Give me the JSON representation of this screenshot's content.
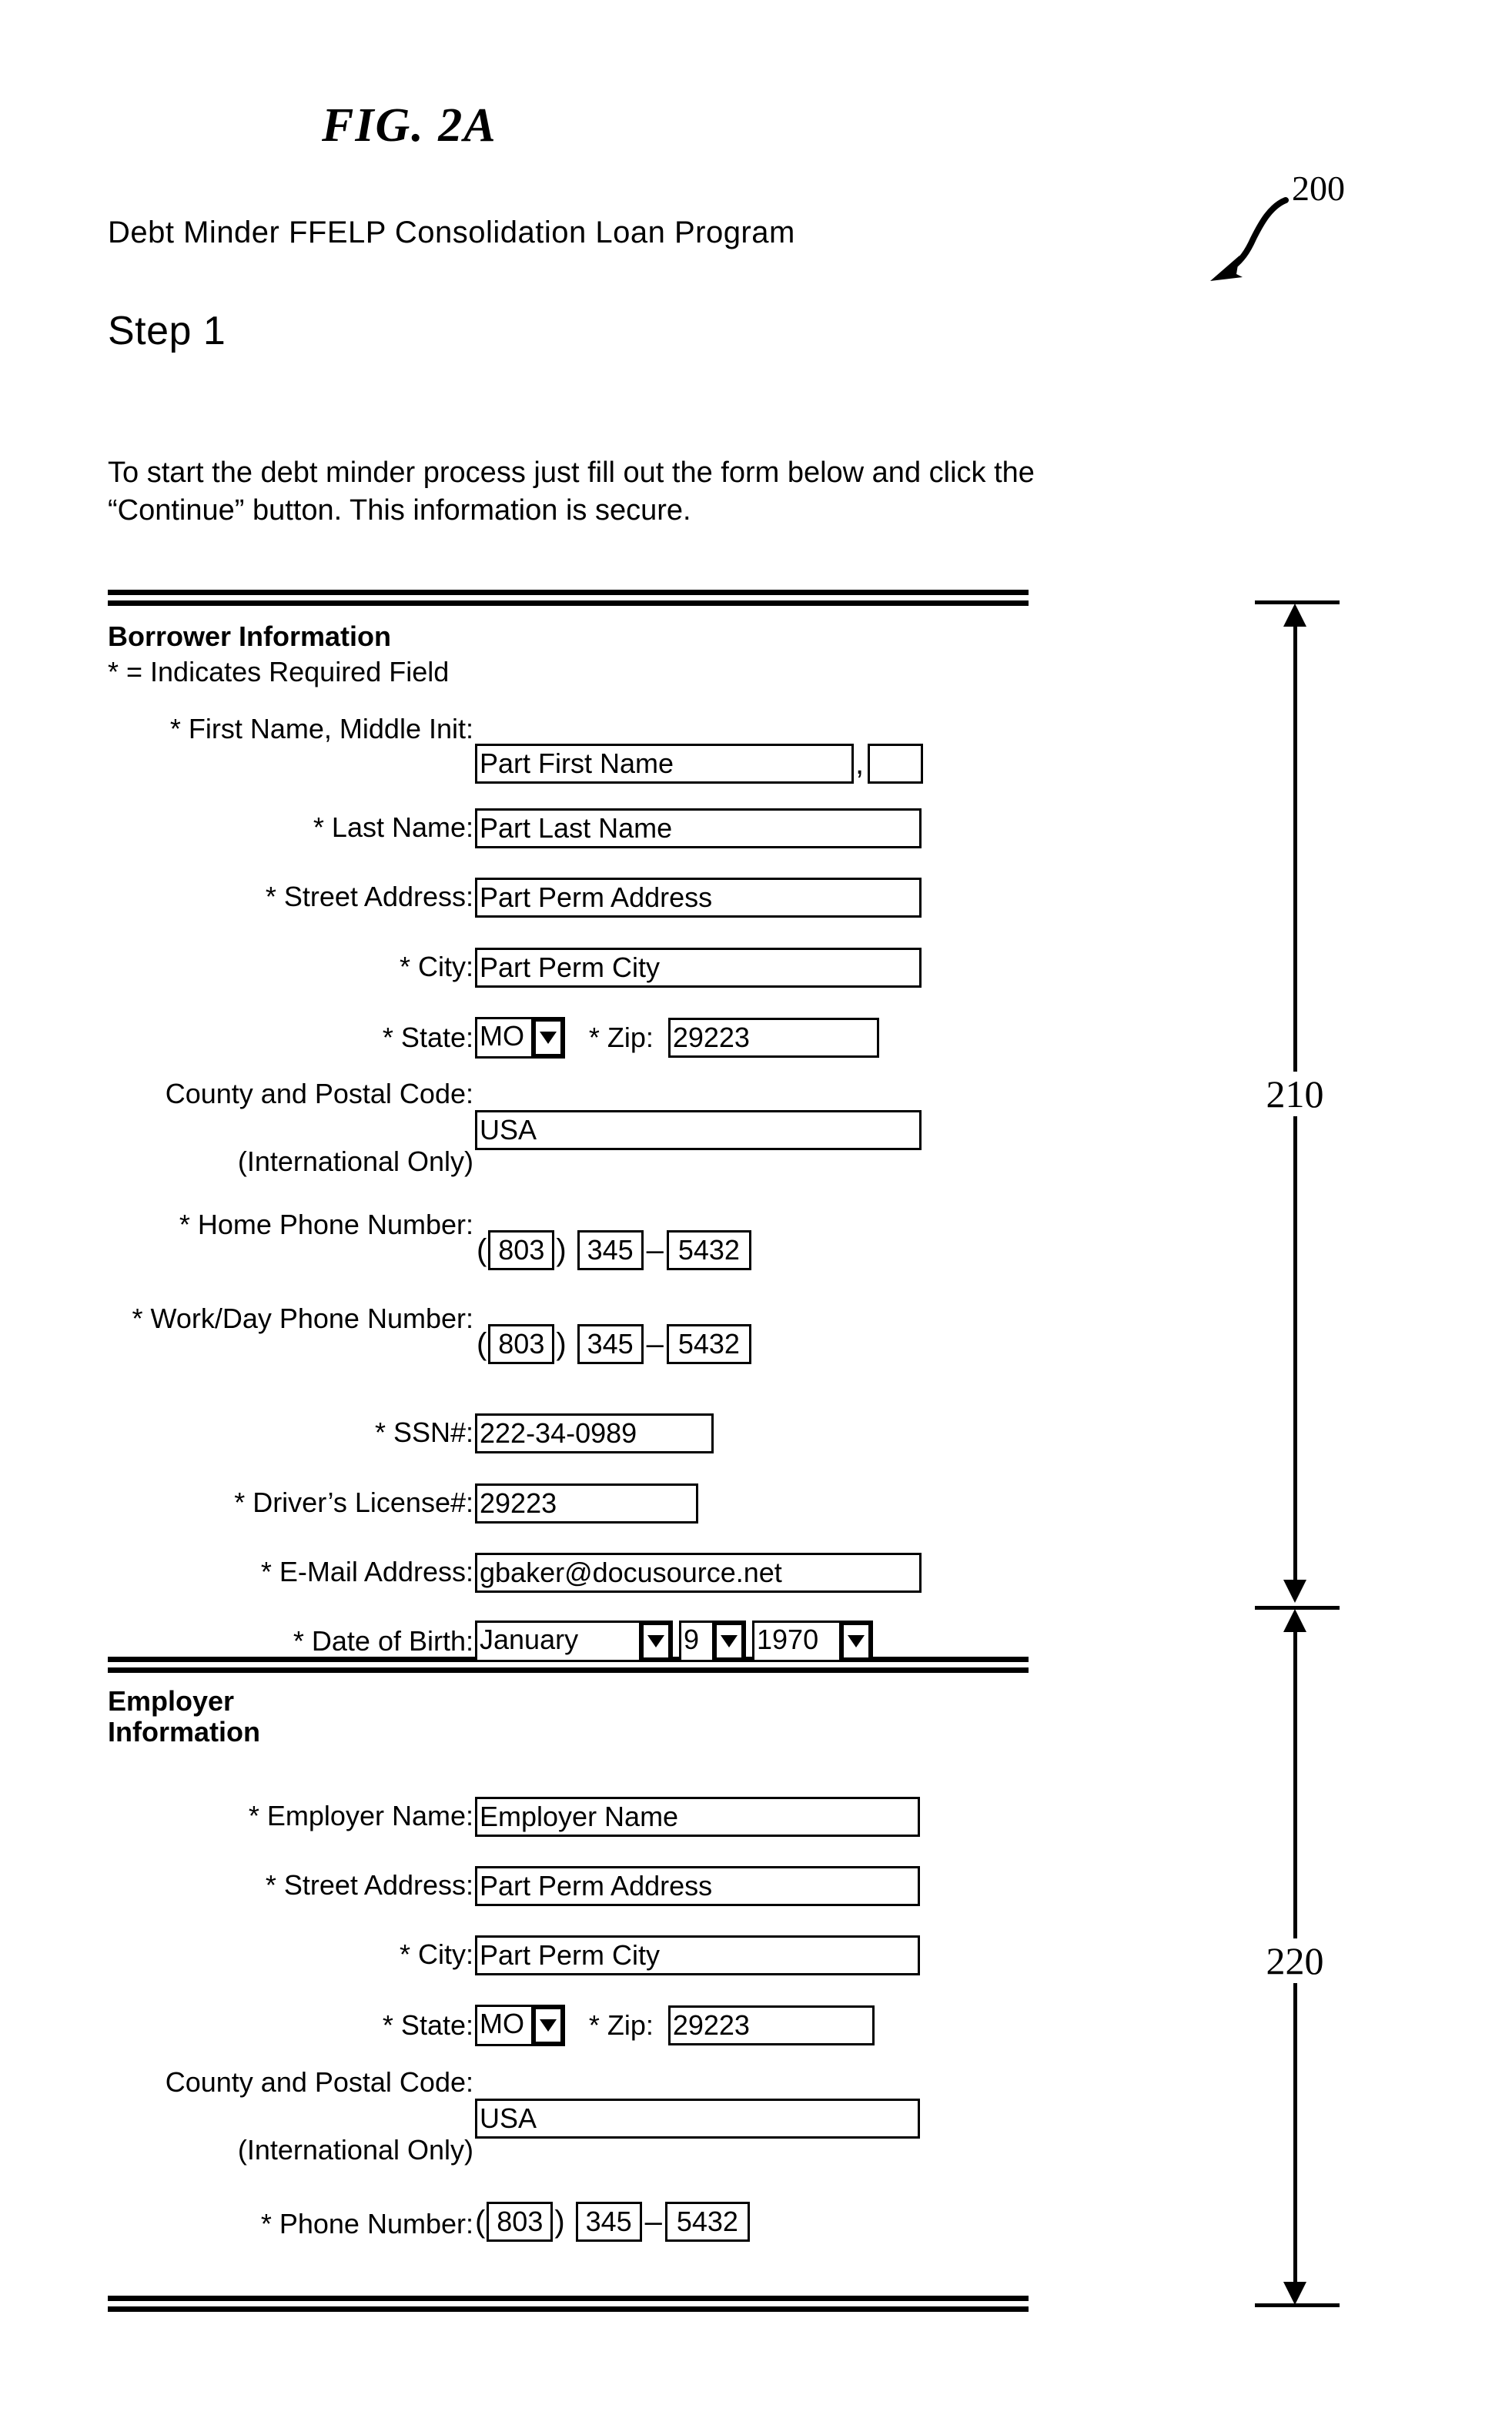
{
  "figure": {
    "title": "FIG.  2A",
    "callout_label": "200",
    "dimension_borrower": "210",
    "dimension_employer": "220"
  },
  "header": {
    "program_title": "Debt Minder FFELP Consolidation Loan Program",
    "step_label": "Step  1",
    "intro_line1": "To start the debt minder process just fill out the form below and click the",
    "intro_line2": "“Continue” button. This information is secure."
  },
  "borrower": {
    "section_title": "Borrower Information",
    "required_note": "* = Indicates Required Field",
    "fields": {
      "first_name_label": "* First Name, Middle Init:",
      "first_name_value": "Part First Name",
      "middle_init_value": "",
      "separator_comma": ",",
      "last_name_label": "* Last Name:",
      "last_name_value": "Part Last Name",
      "street_label": "* Street Address:",
      "street_value": "Part Perm Address",
      "city_label": "* City:",
      "city_value": "Part Perm City",
      "state_label": "* State:",
      "state_value": "MO",
      "zip_label": "* Zip:",
      "zip_value": "29223",
      "county_label": "County and Postal Code:",
      "county_note": "(International Only)",
      "county_value": "USA",
      "home_phone_label": "* Home Phone Number:",
      "home_phone_area": "803",
      "home_phone_prefix": "345",
      "home_phone_line": "5432",
      "work_phone_label": "* Work/Day Phone Number:",
      "work_phone_area": "803",
      "work_phone_prefix": "345",
      "work_phone_line": "5432",
      "ssn_label": "* SSN#:",
      "ssn_value": "222-34-0989",
      "license_label": "* Driver’s License#:",
      "license_value": "29223",
      "email_label": "* E-Mail Address:",
      "email_value": "gbaker@docusource.net",
      "dob_label": "* Date of Birth:",
      "dob_month": "January",
      "dob_day": "9",
      "dob_year": "1970"
    }
  },
  "employer": {
    "section_title_line1": "Employer",
    "section_title_line2": "Information",
    "fields": {
      "employer_name_label": "* Employer Name:",
      "employer_name_value": "Employer Name",
      "street_label": "* Street Address:",
      "street_value": "Part Perm Address",
      "city_label": "* City:",
      "city_value": "Part Perm City",
      "state_label": "* State:",
      "state_value": "MO",
      "zip_label": "* Zip:",
      "zip_value": "29223",
      "county_label": "County and Postal Code:",
      "county_note": "(International Only)",
      "county_value": "USA",
      "phone_label": "* Phone Number:",
      "phone_area": "803",
      "phone_prefix": "345",
      "phone_line": "5432"
    }
  },
  "glyphs": {
    "open_paren": "(",
    "close_paren": ")",
    "dash": "–"
  }
}
